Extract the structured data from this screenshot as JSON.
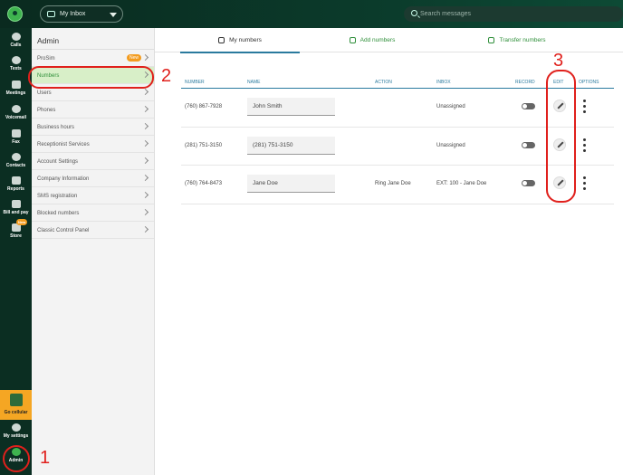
{
  "topbar": {
    "inbox_label": "My Inbox",
    "search_placeholder": "Search messages"
  },
  "rail": {
    "items": [
      {
        "label": "Calls"
      },
      {
        "label": "Texts"
      },
      {
        "label": "Meetings"
      },
      {
        "label": "Voicemail"
      },
      {
        "label": "Fax"
      },
      {
        "label": "Contacts"
      },
      {
        "label": "Reports"
      },
      {
        "label": "Bill and pay"
      },
      {
        "label": "Store",
        "badge": "New"
      }
    ],
    "go_cellular": "Go cellular",
    "my_settings": "My settings",
    "admin": "Admin"
  },
  "admin_side": {
    "title": "Admin",
    "items": [
      {
        "label": "ProSim",
        "badge": "New"
      },
      {
        "label": "Numbers"
      },
      {
        "label": "Users"
      },
      {
        "label": "Phones"
      },
      {
        "label": "Business hours"
      },
      {
        "label": "Receptionist Services"
      },
      {
        "label": "Account Settings"
      },
      {
        "label": "Company Information"
      },
      {
        "label": "SMS registration"
      },
      {
        "label": "Blocked numbers"
      },
      {
        "label": "Classic Control Panel"
      }
    ]
  },
  "tabs": [
    {
      "label": "My numbers"
    },
    {
      "label": "Add numbers"
    },
    {
      "label": "Transfer numbers"
    }
  ],
  "table": {
    "headers": {
      "number": "NUMBER",
      "name": "NAME",
      "action": "ACTION",
      "inbox": "INBOX",
      "record": "RECORD",
      "edit": "EDIT",
      "options": "OPTIONS"
    },
    "rows": [
      {
        "number": "(760) 867-7928",
        "name": "John Smith",
        "action": "",
        "inbox": "Unassigned"
      },
      {
        "number": "(281) 751-3150",
        "name": "(281) 751-3150",
        "action": "",
        "inbox": "Unassigned"
      },
      {
        "number": "(760) 764-8473",
        "name": "Jane Doe",
        "action": "Ring Jane Doe",
        "inbox": "EXT: 100 - Jane Doe"
      }
    ]
  },
  "annotations": {
    "n1": "1",
    "n2": "2",
    "n3": "3"
  },
  "colors": {
    "accent_green": "#2f8f3a",
    "header_blue": "#2a7a9e",
    "annotation_red": "#e0201c",
    "badge_orange": "#f39c1f"
  }
}
